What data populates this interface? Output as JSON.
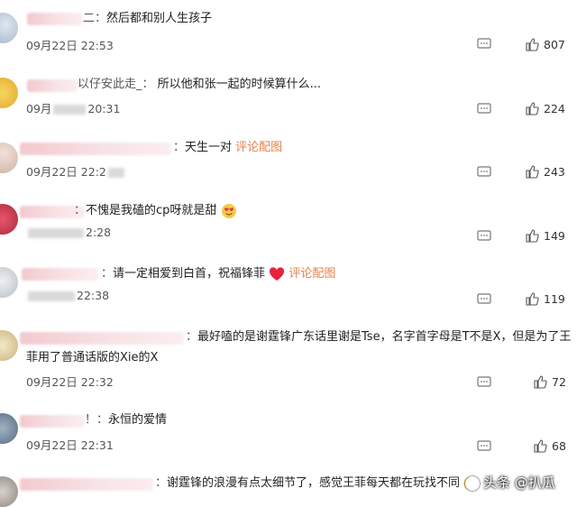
{
  "comments": [
    {
      "nick_tail": "二：",
      "text": "然后都和别人生孩子",
      "time": "09月22日 22:53",
      "likes": "807"
    },
    {
      "nick_tail": "以仔安此走_：",
      "text": "所以他和张一起的时候算什么...",
      "time_prefix": "09月",
      "time_suffix": "20:31",
      "likes": "224"
    },
    {
      "nick_tail": "：",
      "text": "天生一对",
      "link": "评论配图",
      "time_prefix": "09月22日 22:2",
      "time_suffix": "",
      "likes": "243"
    },
    {
      "nick_tail": "：",
      "text": "不愧是我磕的cp呀就是甜",
      "emoji": "heart-eyes-emoji",
      "time_prefix": "",
      "time_suffix": "2:28",
      "likes": "149"
    },
    {
      "nick_tail": "：",
      "text": "请一定相爱到白首，祝福锋菲",
      "emoji": "red-heart-emoji",
      "link": "评论配图",
      "time_prefix": "",
      "time_suffix": "22:38",
      "likes": "119"
    },
    {
      "nick_tail": "：",
      "text": "最好嗑的是谢霆锋广东话里谢是Tse，名字首字母是T不是X，但是为了王",
      "text2": "菲用了普通话版的Xie的X",
      "time": "09月22日 22:32",
      "likes": "72"
    },
    {
      "nick_tail": "！：",
      "text": "永恒的爱情",
      "time": "09月22日 22:31",
      "likes": "68"
    },
    {
      "nick_tail": "：",
      "text": "谢霆锋的浪漫有点太细节了，感觉王菲每天都在玩找不同",
      "emoji": "laugh-emoji"
    }
  ],
  "watermark": {
    "text": "头条 @扒瓜"
  },
  "colors": {
    "link": "#e8804a",
    "nick_blur": "#f2c9cf"
  }
}
